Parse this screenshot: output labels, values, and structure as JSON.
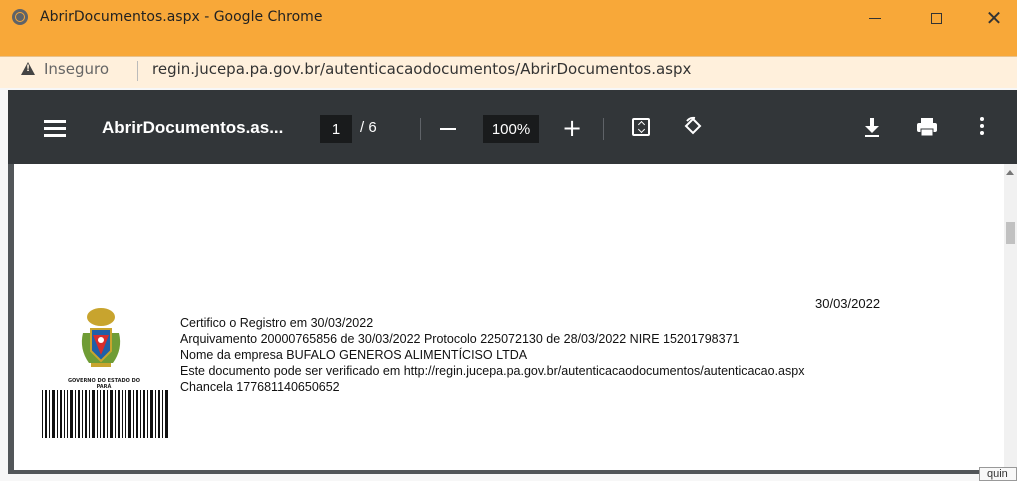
{
  "window": {
    "title": "AbrirDocumentos.aspx - Google Chrome",
    "minimize": "",
    "maximize": "",
    "close": "✕"
  },
  "address": {
    "security_label": "Inseguro",
    "url": "regin.jucepa.pa.gov.br/autenticacaodocumentos/AbrirDocumentos.aspx"
  },
  "pdf_toolbar": {
    "title": "AbrirDocumentos.as...",
    "current_page": "1",
    "page_separator_total": "/  6",
    "zoom": "100%",
    "zoom_in": "+"
  },
  "certificate": {
    "date": "30/03/2022",
    "lines": [
      "Certifico o Registro em 30/03/2022",
      "Arquivamento 20000765856 de 30/03/2022 Protocolo 225072130 de 28/03/2022 NIRE 15201798371",
      "Nome da empresa BUFALO GENEROS ALIMENTÍCISO LTDA",
      "Este documento pode ser verificado em http://regin.jucepa.pa.gov.br/autenticacaodocumentos/autenticacao.aspx",
      "Chancela 177681140650652"
    ],
    "seal_caption": "GOVERNO DO ESTADO DO PARÁ"
  },
  "tooltip": {
    "text": "quin"
  },
  "colors": {
    "titlebar": "#f8a839",
    "address_bar": "#fff0dc",
    "pdf_toolbar": "#323639",
    "pdf_background": "#525659"
  }
}
